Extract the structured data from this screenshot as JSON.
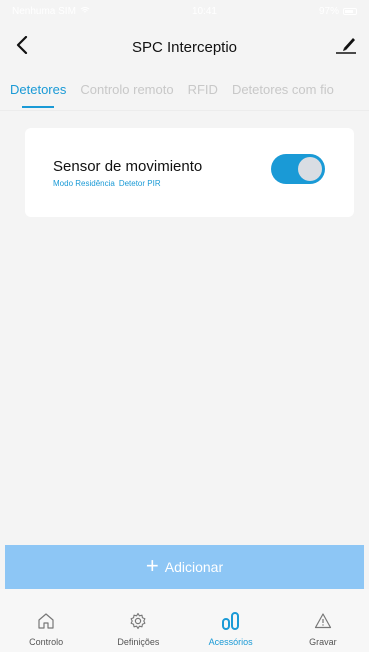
{
  "status_bar": {
    "left": "Nenhuma SIM",
    "time": "10:41",
    "battery": "97%"
  },
  "header": {
    "title": "SPC Interceptio",
    "back_icon": "chevron-left-icon",
    "edit_icon": "edit-pencil-icon"
  },
  "tabs": [
    {
      "label": "Detetores",
      "active": true
    },
    {
      "label": "Controlo remoto",
      "active": false
    },
    {
      "label": "RFID",
      "active": false
    },
    {
      "label": "Detetores com fio",
      "active": false
    }
  ],
  "devices": [
    {
      "name": "Sensor de movimiento",
      "tag1": "Modo Residência",
      "tag2": "Detetor PIR",
      "enabled": true
    }
  ],
  "add_button": {
    "icon": "plus-icon",
    "label": "Adicionar"
  },
  "bottom_nav": [
    {
      "label": "Controlo",
      "icon": "home-icon",
      "active": false
    },
    {
      "label": "Definições",
      "icon": "settings-icon",
      "active": false
    },
    {
      "label": "Acessórios",
      "icon": "accessories-icon",
      "active": true
    },
    {
      "label": "Gravar",
      "icon": "warning-icon",
      "active": false
    }
  ],
  "colors": {
    "accent": "#1a9ad6",
    "add_bar": "#8dc6f5",
    "background": "#f4f4f4"
  }
}
